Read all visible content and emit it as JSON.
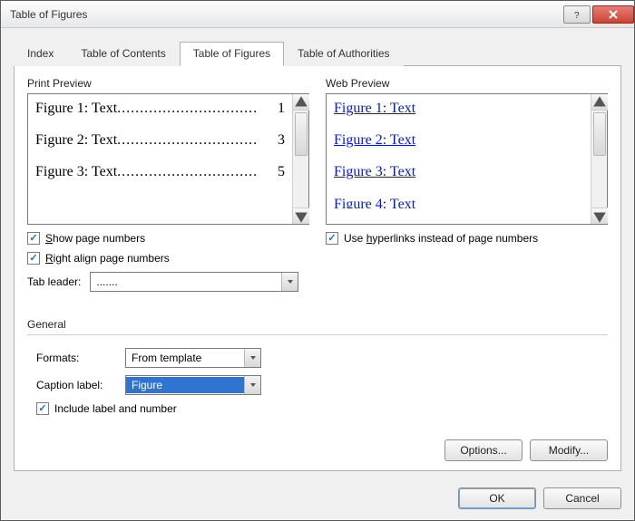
{
  "window": {
    "title": "Table of Figures"
  },
  "tabs": {
    "items": [
      {
        "label": "Index"
      },
      {
        "label": "Table of Contents"
      },
      {
        "label": "Table of Figures"
      },
      {
        "label": "Table of Authorities"
      }
    ],
    "active_index": 2
  },
  "print_preview": {
    "title": "Print Preview",
    "entries": [
      {
        "label": "Figure 1: Text",
        "page": "1"
      },
      {
        "label": "Figure 2: Text",
        "page": "3"
      },
      {
        "label": "Figure 3: Text",
        "page": "5"
      }
    ],
    "dot_leader": "..............................."
  },
  "web_preview": {
    "title": "Web Preview",
    "links": [
      "Figure 1: Text",
      "Figure 2: Text",
      "Figure 3: Text",
      "Figure 4: Text"
    ]
  },
  "options_left": {
    "show_page_numbers": {
      "label": "Show page numbers",
      "checked": true
    },
    "right_align": {
      "label": "Right align page numbers",
      "checked": true
    },
    "tab_leader_label": "Tab leader:",
    "tab_leader_value": "......."
  },
  "options_right": {
    "use_hyperlinks": {
      "label": "Use hyperlinks instead of page numbers",
      "checked": true
    }
  },
  "general": {
    "title": "General",
    "formats_label": "Formats:",
    "formats_value": "From template",
    "caption_label_label": "Caption label:",
    "caption_label_value": "Figure",
    "include_label": {
      "label": "Include label and number",
      "checked": true
    }
  },
  "buttons": {
    "options": "Options...",
    "modify": "Modify...",
    "ok": "OK",
    "cancel": "Cancel"
  }
}
